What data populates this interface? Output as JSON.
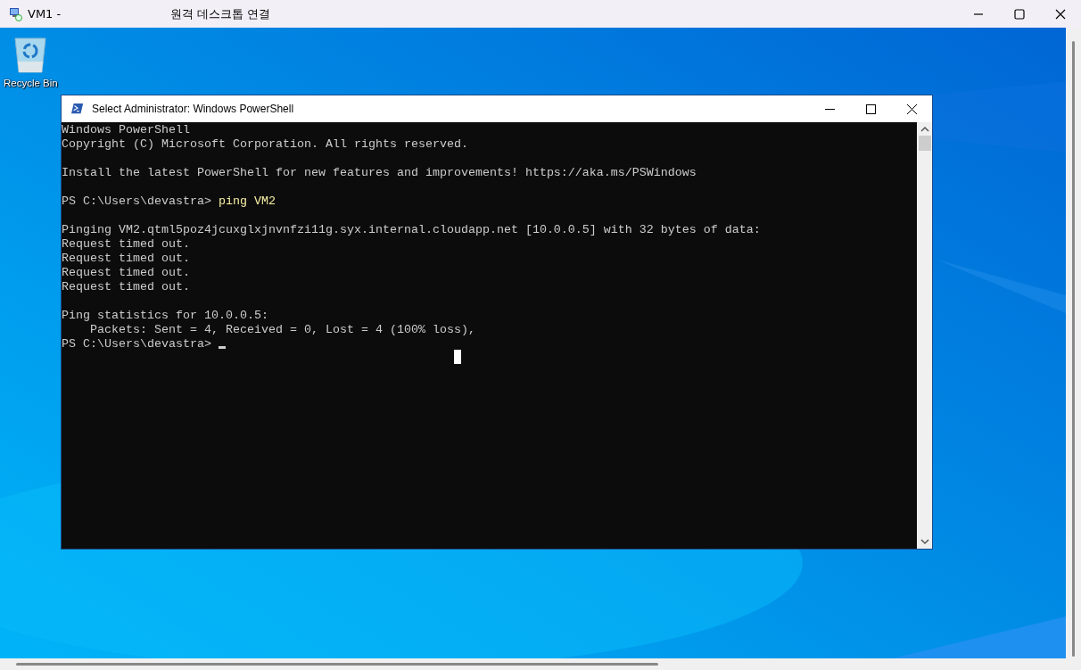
{
  "window": {
    "title_left": "VM1 -",
    "title": "원격 데스크톱 연결"
  },
  "desktop": {
    "icons": [
      {
        "label": "Recycle Bin"
      }
    ]
  },
  "console": {
    "title": "Select Administrator: Windows PowerShell",
    "lines": [
      {
        "kind": "output",
        "text": "Windows PowerShell"
      },
      {
        "kind": "output",
        "text": "Copyright (C) Microsoft Corporation. All rights reserved."
      },
      {
        "kind": "blank"
      },
      {
        "kind": "output",
        "text": "Install the latest PowerShell for new features and improvements! https://aka.ms/PSWindows"
      },
      {
        "kind": "blank"
      },
      {
        "kind": "command",
        "prompt": "PS C:\\Users\\devastra>",
        "command": "ping VM2"
      },
      {
        "kind": "blank"
      },
      {
        "kind": "output",
        "text": "Pinging VM2.qtml5poz4jcuxglxjnvnfzi11g.syx.internal.cloudapp.net [10.0.0.5] with 32 bytes of data:"
      },
      {
        "kind": "output",
        "text": "Request timed out."
      },
      {
        "kind": "output",
        "text": "Request timed out."
      },
      {
        "kind": "output",
        "text": "Request timed out."
      },
      {
        "kind": "output",
        "text": "Request timed out."
      },
      {
        "kind": "blank"
      },
      {
        "kind": "output",
        "text": "Ping statistics for 10.0.0.5:"
      },
      {
        "kind": "output",
        "text": "    Packets: Sent = 4, Received = 0, Lost = 4 (100% loss),"
      },
      {
        "kind": "prompt",
        "prompt": "PS C:\\Users\\devastra>"
      }
    ]
  }
}
